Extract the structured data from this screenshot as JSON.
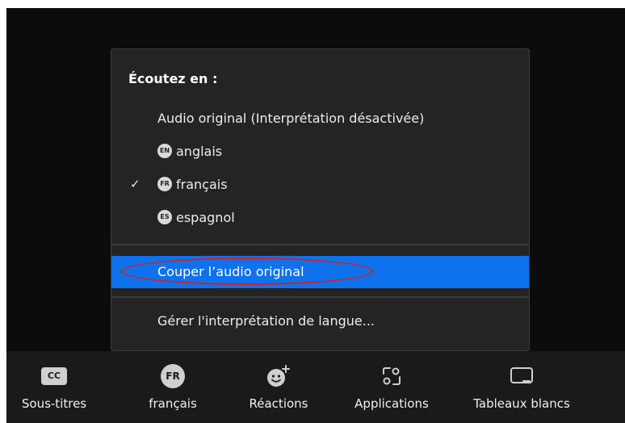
{
  "menu": {
    "heading": "Écoutez en :",
    "original_audio": "Audio original (Interprétation désactivée)",
    "languages": [
      {
        "code": "EN",
        "label": "anglais",
        "selected": false
      },
      {
        "code": "FR",
        "label": "français",
        "selected": true
      },
      {
        "code": "ES",
        "label": "espagnol",
        "selected": false
      }
    ],
    "checkmark": "✓",
    "mute_original": "Couper l’audio original",
    "manage": "Gérer l'interprétation de langue..."
  },
  "toolbar": {
    "captions": {
      "icon_text": "CC",
      "label": "Sous-titres"
    },
    "interpretation": {
      "icon_text": "FR",
      "label": "français"
    },
    "reactions": {
      "label": "Réactions"
    },
    "apps": {
      "label": "Applications"
    },
    "whiteboards": {
      "label": "Tableaux blancs"
    }
  },
  "colors": {
    "highlight": "#0e72ed",
    "annotation": "#d81e1e",
    "menu_bg": "#242424",
    "toolbar_bg": "#1a1a1a"
  }
}
